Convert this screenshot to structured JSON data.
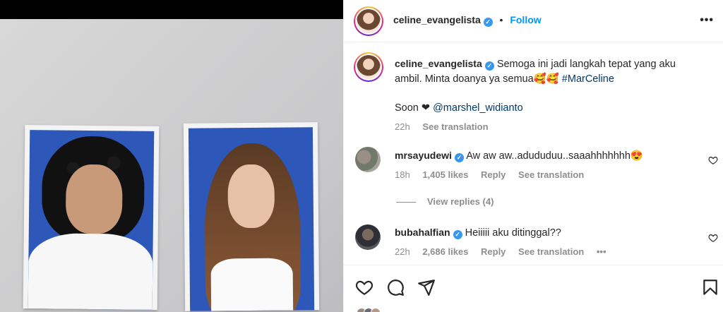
{
  "post": {
    "author": "celine_evangelista",
    "follow_label": "Follow",
    "more_label": "•••",
    "dot": "•"
  },
  "caption": {
    "author": "celine_evangelista",
    "text": "Semoga ini jadi langkah tepat yang aku ambil. Minta doanya ya semua🥰🥰 ",
    "hashtag": "#MarCeline",
    "soon_text": "Soon ❤ ",
    "mention": "@marshel_widianto",
    "time": "22h",
    "see_translation": "See translation"
  },
  "comments": [
    {
      "author": "mrsayudewi",
      "text": "Aw aw aw..adududuu..saaahhhhhhh😍",
      "time": "18h",
      "likes": "1,405 likes",
      "reply": "Reply",
      "see_translation": "See translation",
      "view_replies": "View replies (4)"
    },
    {
      "author": "bubahalfian",
      "text": "Heiiiii aku ditinggal??",
      "time": "22h",
      "likes": "2,686 likes",
      "reply": "Reply",
      "see_translation": "See translation",
      "more": "•••"
    }
  ],
  "icons": [
    "heart-icon",
    "comment-icon",
    "share-icon",
    "bookmark-icon",
    "verified-icon",
    "more-icon"
  ],
  "colors": {
    "link": "#0095f6",
    "hashtag": "#00376b",
    "muted": "#8e8e8e",
    "verified": "#3897f0",
    "photo_blue": "#2d57b8"
  }
}
